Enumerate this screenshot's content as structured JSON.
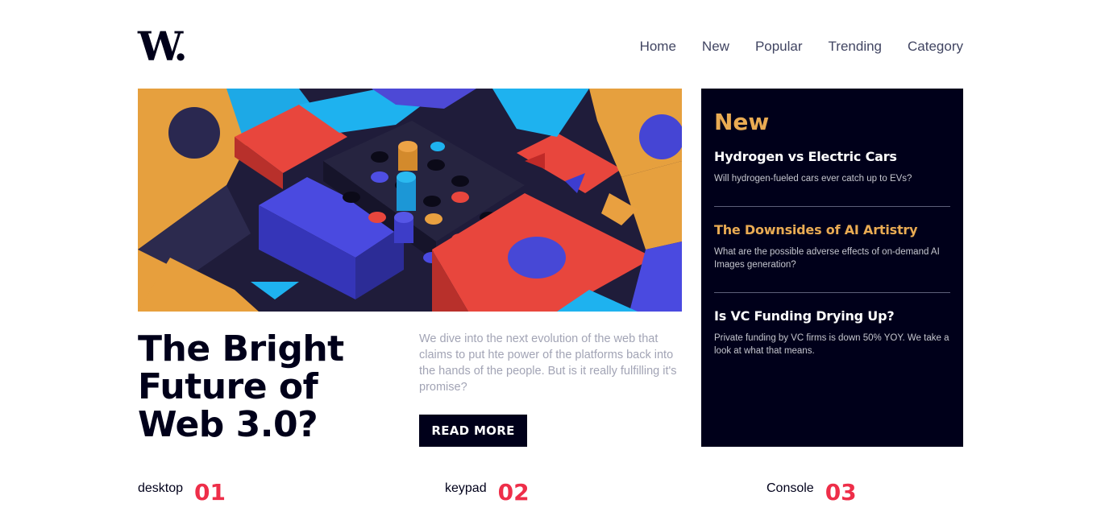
{
  "brand": {
    "logo_text": "W",
    "logo_dot": "."
  },
  "nav": {
    "items": [
      "Home",
      "New",
      "Popular",
      "Trending",
      "Category"
    ]
  },
  "hero": {
    "title": "The Bright Future of Web 3.0?",
    "description": "We dive into the next evolution of the web that claims to put hte power of the platforms back into the hands of the people. But is it really fulfilling it's promise?",
    "button_label": "READ MORE"
  },
  "sidebar": {
    "heading": "New",
    "items": [
      {
        "title": "Hydrogen vs Electric Cars",
        "summary": "Will hydrogen-fueled cars ever catch up to EVs?"
      },
      {
        "title": "The Downsides of AI Artistry",
        "summary": "What are the possible adverse effects of on-demand AI Images generation?"
      },
      {
        "title": "Is VC Funding Drying Up?",
        "summary": "Private funding by VC firms is down 50% YOY. We take a look at what that means."
      }
    ]
  },
  "bottom": {
    "items": [
      {
        "label": "desktop",
        "number": "01"
      },
      {
        "label": "keypad",
        "number": "02"
      },
      {
        "label": "Console",
        "number": "03"
      }
    ]
  },
  "colors": {
    "dark": "#00001a",
    "accent_orange": "#e9ab53",
    "accent_red": "#ee2e49",
    "muted_text": "#a2a4b5"
  }
}
